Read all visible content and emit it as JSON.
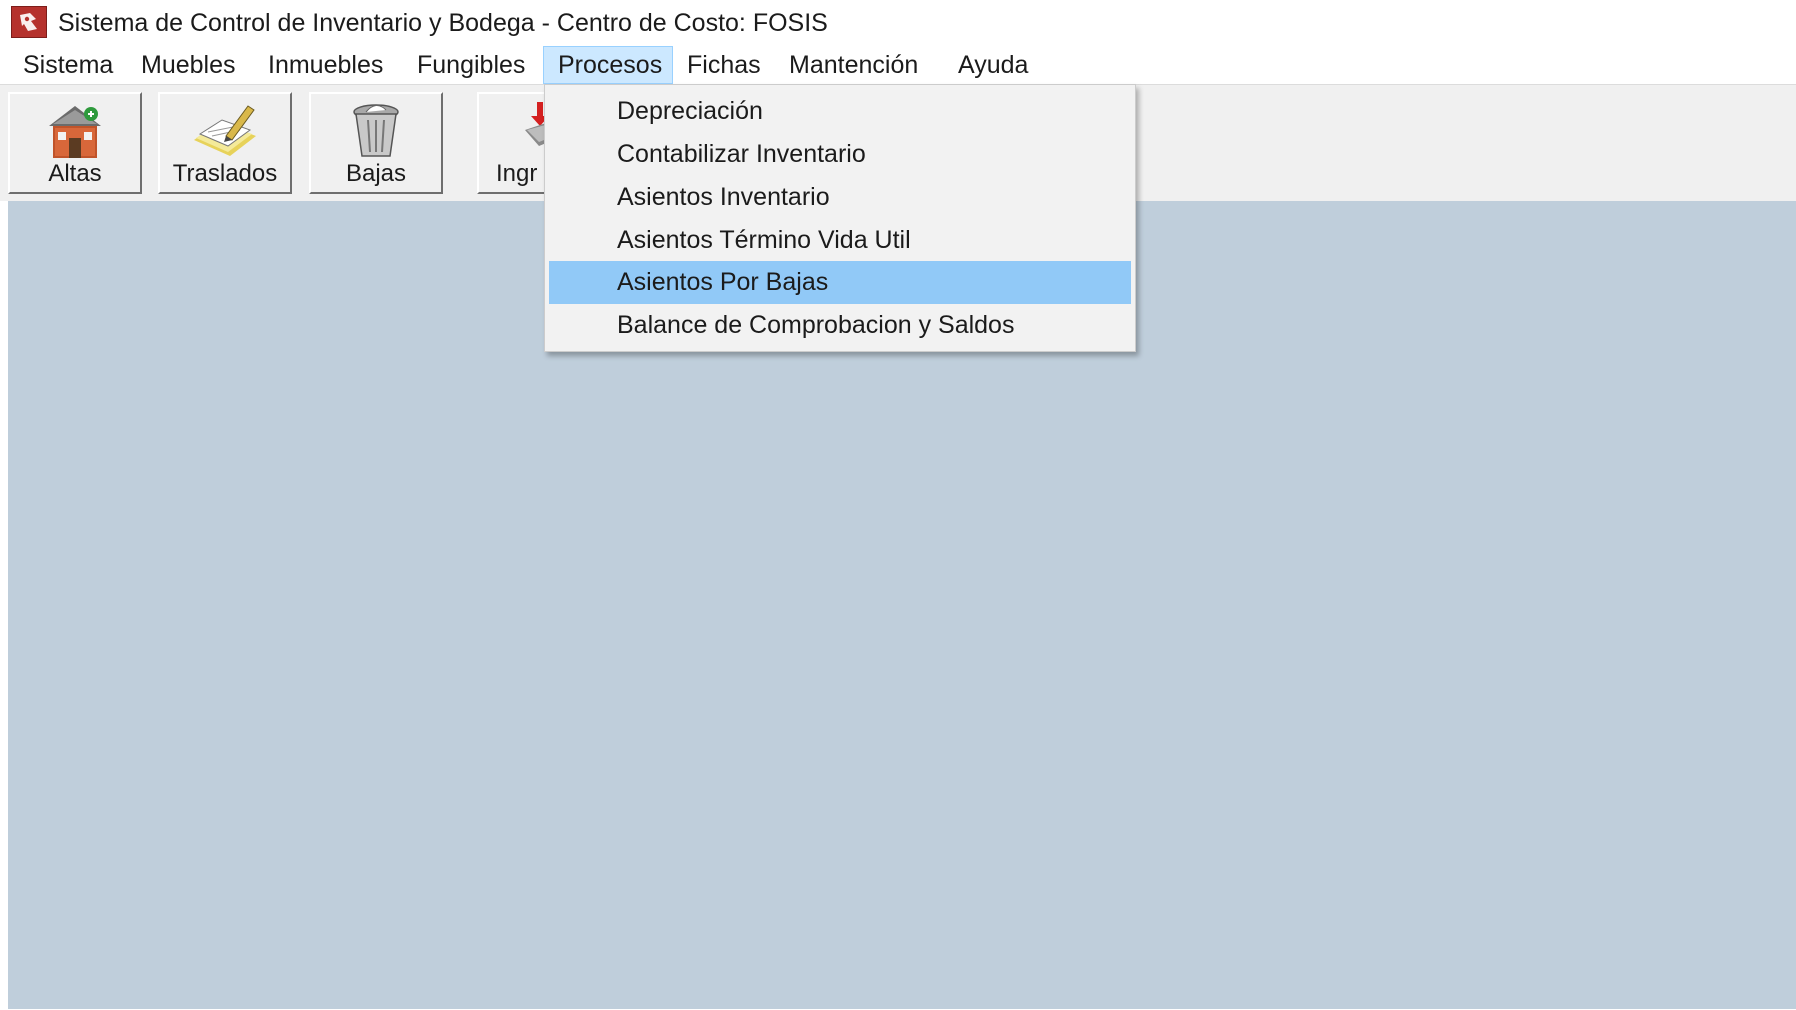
{
  "window": {
    "title": "Sistema de Control de Inventario y Bodega - Centro de Costo: FOSIS",
    "icon": "app-logo-icon"
  },
  "menubar": {
    "items": [
      {
        "label": "Sistema"
      },
      {
        "label": "Muebles"
      },
      {
        "label": "Inmuebles"
      },
      {
        "label": "Fungibles"
      },
      {
        "label": "Procesos",
        "active": true
      },
      {
        "label": "Fichas"
      },
      {
        "label": "Mantención"
      },
      {
        "label": "Ayuda"
      }
    ]
  },
  "toolbar": {
    "buttons": [
      {
        "label": "Altas",
        "icon": "house-add-icon"
      },
      {
        "label": "Traslados",
        "icon": "transfer-pencil-icon"
      },
      {
        "label": "Bajas",
        "icon": "trash-bin-icon"
      },
      {
        "label": "Ingr",
        "icon": "ingreso-icon"
      }
    ]
  },
  "procesos_menu": {
    "items": [
      {
        "label": "Depreciación"
      },
      {
        "label": "Contabilizar Inventario"
      },
      {
        "label": "Asientos Inventario"
      },
      {
        "label": "Asientos Término Vida Util"
      },
      {
        "label": "Asientos Por Bajas",
        "highlighted": true
      },
      {
        "label": "Balance de Comprobacion y Saldos"
      }
    ]
  },
  "colors": {
    "workspace": "#bfcedb",
    "menu_highlight": "#91c9f7",
    "active_menu": "#cce8ff"
  }
}
